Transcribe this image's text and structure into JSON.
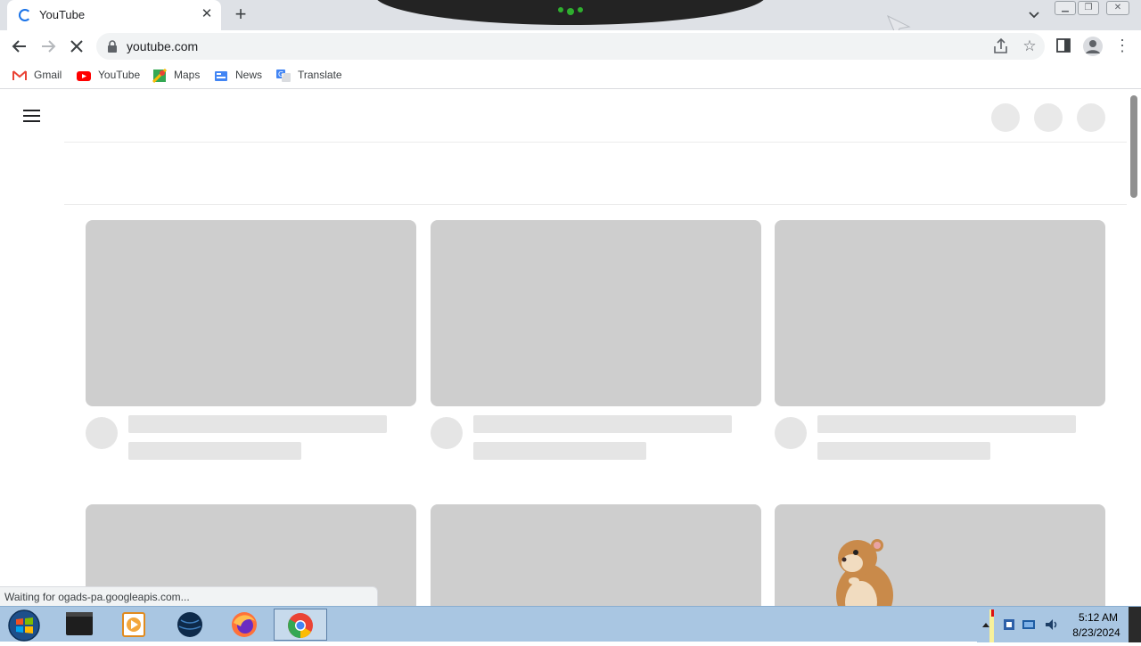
{
  "tab": {
    "title": "YouTube",
    "close_glyph": "✕",
    "new_tab_glyph": "+",
    "search_glyph": "⌄"
  },
  "toolbar": {
    "url": "youtube.com",
    "back_glyph": "←",
    "forward_glyph": "→",
    "stop_glyph": "✕"
  },
  "bookmarks": [
    {
      "label": "Gmail",
      "icon": "gmail-icon"
    },
    {
      "label": "YouTube",
      "icon": "youtube-icon"
    },
    {
      "label": "Maps",
      "icon": "maps-icon"
    },
    {
      "label": "News",
      "icon": "news-icon"
    },
    {
      "label": "Translate",
      "icon": "translate-icon"
    }
  ],
  "status": {
    "text": "Waiting for ogads-pa.googleapis.com..."
  },
  "taskbar": {
    "apps": [
      "terminal-app",
      "media-player-app",
      "globe-app",
      "firefox-app",
      "chrome-app"
    ],
    "active_app": "chrome-app",
    "time": "5:12 AM",
    "date": "8/23/2024"
  },
  "colors": {
    "accent": "#1a73e8",
    "skeleton": "#cecece",
    "skeleton_light": "#e5e5e5",
    "taskbar": "#a9c6e2"
  }
}
